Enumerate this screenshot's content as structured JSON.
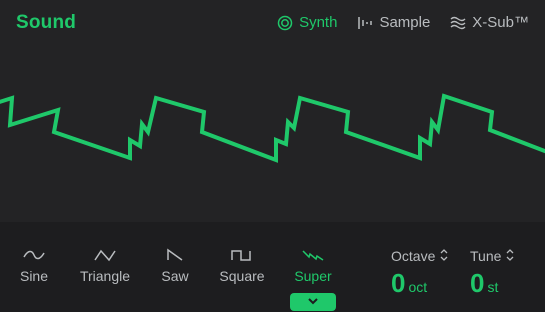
{
  "header": {
    "title": "Sound",
    "tabs": [
      {
        "label": "Synth",
        "icon": "target-icon",
        "active": true
      },
      {
        "label": "Sample",
        "icon": "waveform-bars-icon",
        "active": false
      },
      {
        "label": "X-Sub™",
        "icon": "wavy-lines-icon",
        "active": false
      }
    ]
  },
  "waveforms": [
    {
      "label": "Sine",
      "icon": "sine-wave-icon",
      "active": false
    },
    {
      "label": "Triangle",
      "icon": "triangle-wave-icon",
      "active": false
    },
    {
      "label": "Saw",
      "icon": "saw-wave-icon",
      "active": false
    },
    {
      "label": "Square",
      "icon": "square-wave-icon",
      "active": false
    },
    {
      "label": "Super",
      "icon": "super-saw-icon",
      "active": true
    }
  ],
  "octave": {
    "label": "Octave",
    "value": "0",
    "unit": "oct"
  },
  "tune": {
    "label": "Tune",
    "value": "0",
    "unit": "st"
  },
  "colors": {
    "accent": "#1fc86a",
    "background": "#1f1f21",
    "text": "#b9bcbf"
  }
}
